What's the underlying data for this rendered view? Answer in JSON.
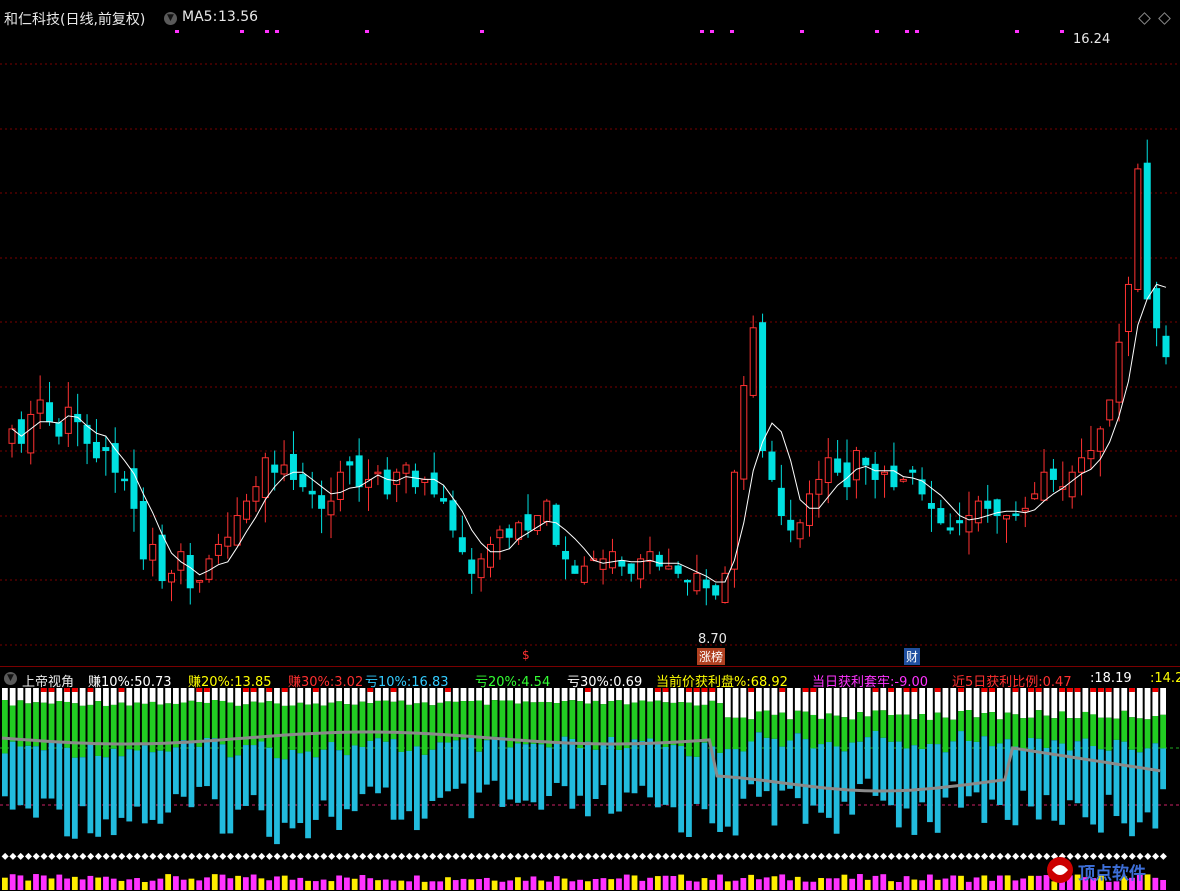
{
  "header": {
    "stock_name": "和仁科技(日线,前复权)",
    "ma_label": "MA5:",
    "ma_value": "13.56"
  },
  "annotations": {
    "high_label": "16.24",
    "low_label": "8.70",
    "tag_s": "$",
    "tag_zhangbang": "涨榜",
    "tag_cai": "财"
  },
  "sub_indicator": {
    "name": "上帝视角",
    "items": [
      {
        "label": "赚10%:",
        "value": "50.73",
        "color": "#ffffff"
      },
      {
        "label": "赚20%:",
        "value": "13.85",
        "color": "#ffff00"
      },
      {
        "label": "赚30%:",
        "value": "3.02",
        "color": "#ff3030"
      },
      {
        "label": "亏10%:",
        "value": "16.83",
        "color": "#33ccff"
      },
      {
        "label": "亏20%:",
        "value": "4.54",
        "color": "#33ff33"
      },
      {
        "label": "亏30%:",
        "value": "0.69",
        "color": "#ffffff"
      },
      {
        "label": "当前价获利盘%:",
        "value": "68.92",
        "color": "#ffff00"
      },
      {
        "label": "当日获利套牢:",
        "value": "-9.00",
        "color": "#ff33ff"
      },
      {
        "label": "近5日获利比例:",
        "value": "0.47",
        "color": "#ff3030"
      },
      {
        "label": ":",
        "value": "18.19",
        "color": "#ffffff"
      },
      {
        "label": ":",
        "value": "14.2",
        "color": "#ffff00"
      }
    ]
  },
  "watermark": "顶点软件",
  "colors": {
    "up": "#ff3232",
    "down": "#00e0e0",
    "ma": "#ffffff",
    "grid": "#7a0000",
    "profit": "#ffffff",
    "green_band": "#22cc22",
    "cyan_band": "#22bbdd"
  },
  "chart_data": {
    "type": "candlestick",
    "series": [
      {
        "name": "MA5",
        "values_label": "13.56"
      }
    ],
    "price_range_visible": [
      8.7,
      16.24
    ],
    "closes": [
      11.2,
      11.0,
      11.4,
      11.6,
      11.3,
      11.1,
      11.5,
      11.3,
      11.0,
      10.8,
      10.9,
      10.6,
      10.5,
      10.1,
      9.4,
      9.6,
      9.1,
      9.2,
      9.5,
      9.0,
      9.1,
      9.4,
      9.6,
      9.7,
      10.0,
      10.2,
      10.4,
      10.8,
      10.6,
      10.7,
      10.5,
      10.4,
      10.3,
      10.1,
      10.2,
      10.6,
      10.7,
      10.4,
      10.5,
      10.6,
      10.3,
      10.6,
      10.7,
      10.4,
      10.5,
      10.3,
      10.2,
      9.8,
      9.5,
      9.2,
      9.4,
      9.6,
      9.8,
      9.7,
      9.9,
      9.8,
      10.0,
      10.2,
      9.6,
      9.4,
      9.2,
      9.3,
      9.4,
      9.4,
      9.5,
      9.3,
      9.2,
      9.4,
      9.5,
      9.3,
      9.3,
      9.2,
      9.1,
      9.2,
      9.0,
      8.9,
      9.2,
      10.6,
      11.8,
      12.6,
      10.9,
      10.5,
      10.0,
      9.8,
      9.9,
      10.3,
      10.5,
      10.8,
      10.6,
      10.4,
      10.9,
      10.7,
      10.5,
      10.6,
      10.4,
      10.5,
      10.6,
      10.3,
      10.1,
      9.9,
      9.8,
      9.9,
      10.0,
      10.2,
      10.1,
      10.0,
      10.0,
      10.0,
      10.1,
      10.3,
      10.6,
      10.5,
      10.4,
      10.6,
      10.8,
      10.9,
      11.2,
      11.6,
      12.4,
      13.2,
      14.8,
      13.0,
      12.6,
      12.2
    ]
  }
}
